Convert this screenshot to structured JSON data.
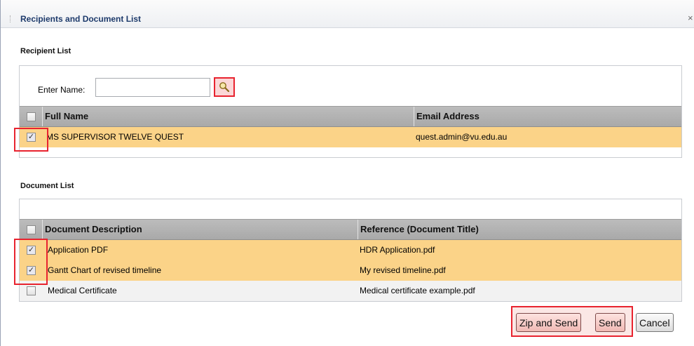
{
  "dialog": {
    "title": "Recipients and Document List",
    "close_glyph": "×"
  },
  "recipients": {
    "section_label": "Recipient List",
    "name_label": "Enter Name:",
    "name_value": "",
    "search_icon": "search-icon",
    "columns": [
      "Full Name",
      "Email Address"
    ],
    "rows": [
      {
        "full_name": "MS SUPERVISOR TWELVE QUEST",
        "email": "quest.admin@vu.edu.au",
        "checked": true
      }
    ]
  },
  "documents": {
    "section_label": "Document List",
    "columns": [
      "Document Description",
      "Reference (Document Title)"
    ],
    "rows": [
      {
        "description": "Application PDF",
        "reference": "HDR Application.pdf",
        "checked": true
      },
      {
        "description": "Gantt Chart of revised timeline",
        "reference": "My revised timeline.pdf",
        "checked": true
      },
      {
        "description": "Medical Certificate",
        "reference": "Medical certificate example.pdf",
        "checked": false
      }
    ]
  },
  "actions": {
    "zip_send": "Zip and Send",
    "send": "Send",
    "cancel": "Cancel"
  },
  "colors": {
    "highlight": "#e8232f",
    "selected_row": "#fbd388",
    "header": "#a9a9a9"
  }
}
